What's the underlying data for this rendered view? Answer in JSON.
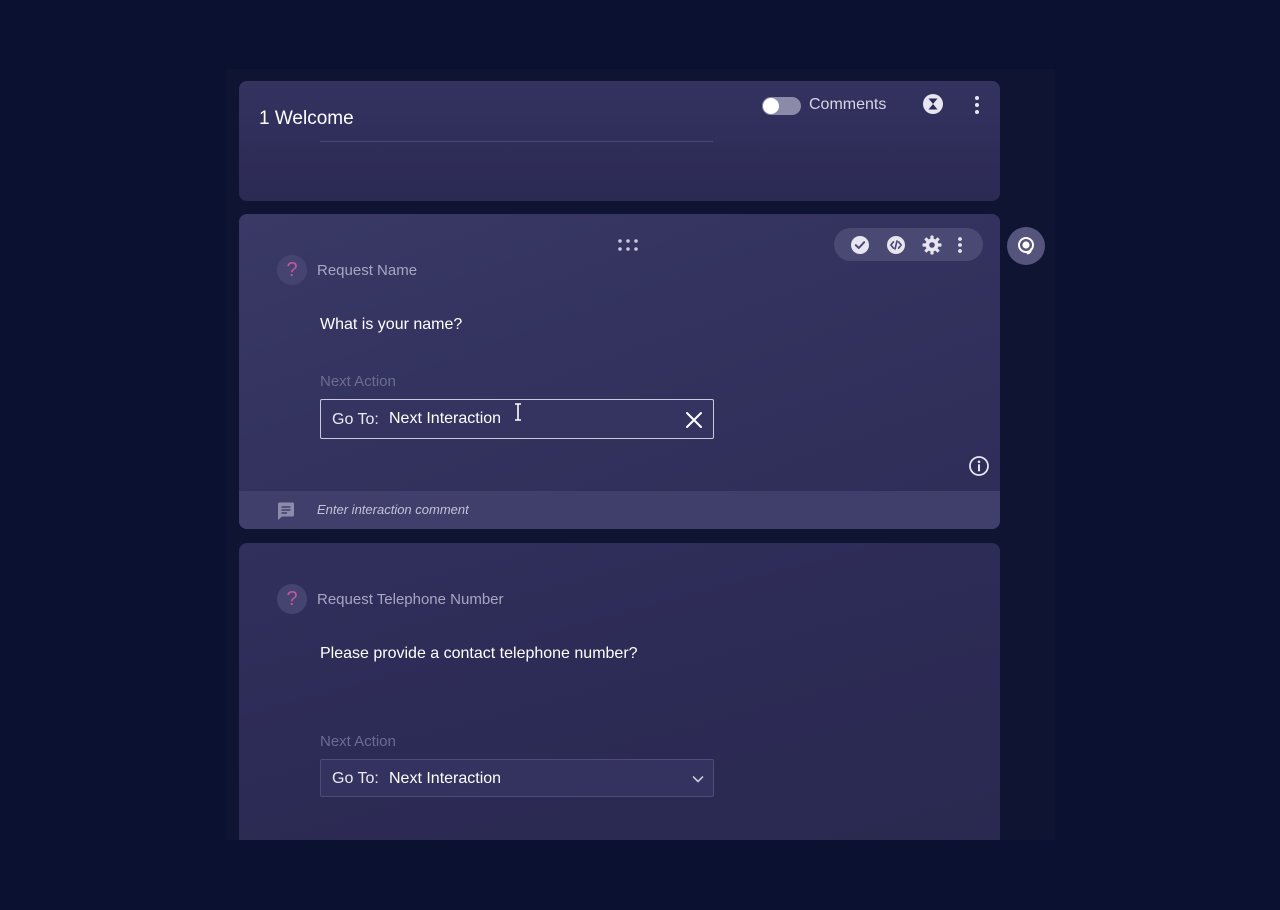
{
  "header": {
    "title": "1 Welcome",
    "comments_label": "Comments",
    "comments_toggle_on": false
  },
  "interactions": [
    {
      "type_symbol": "?",
      "title": "Request Name",
      "prompt": "What is your name?",
      "next_action_label": "Next Action",
      "goto_prefix": "Go To:",
      "goto_value": "Next Interaction",
      "comment_placeholder": "Enter interaction comment"
    },
    {
      "type_symbol": "?",
      "title": "Request Telephone Number",
      "prompt": "Please provide a contact telephone number?",
      "next_action_label": "Next Action",
      "goto_prefix": "Go To:",
      "goto_value": "Next Interaction"
    }
  ],
  "icons": {
    "header": [
      "hourglass-icon",
      "more-vertical-icon"
    ],
    "interaction_toolbar": [
      "check-circle-icon",
      "code-icon",
      "gear-icon",
      "more-vertical-icon"
    ],
    "side": "agent-icon"
  },
  "colors": {
    "background": "#0b1130",
    "card": "#312f5c",
    "accent_question": "#c3569f"
  }
}
